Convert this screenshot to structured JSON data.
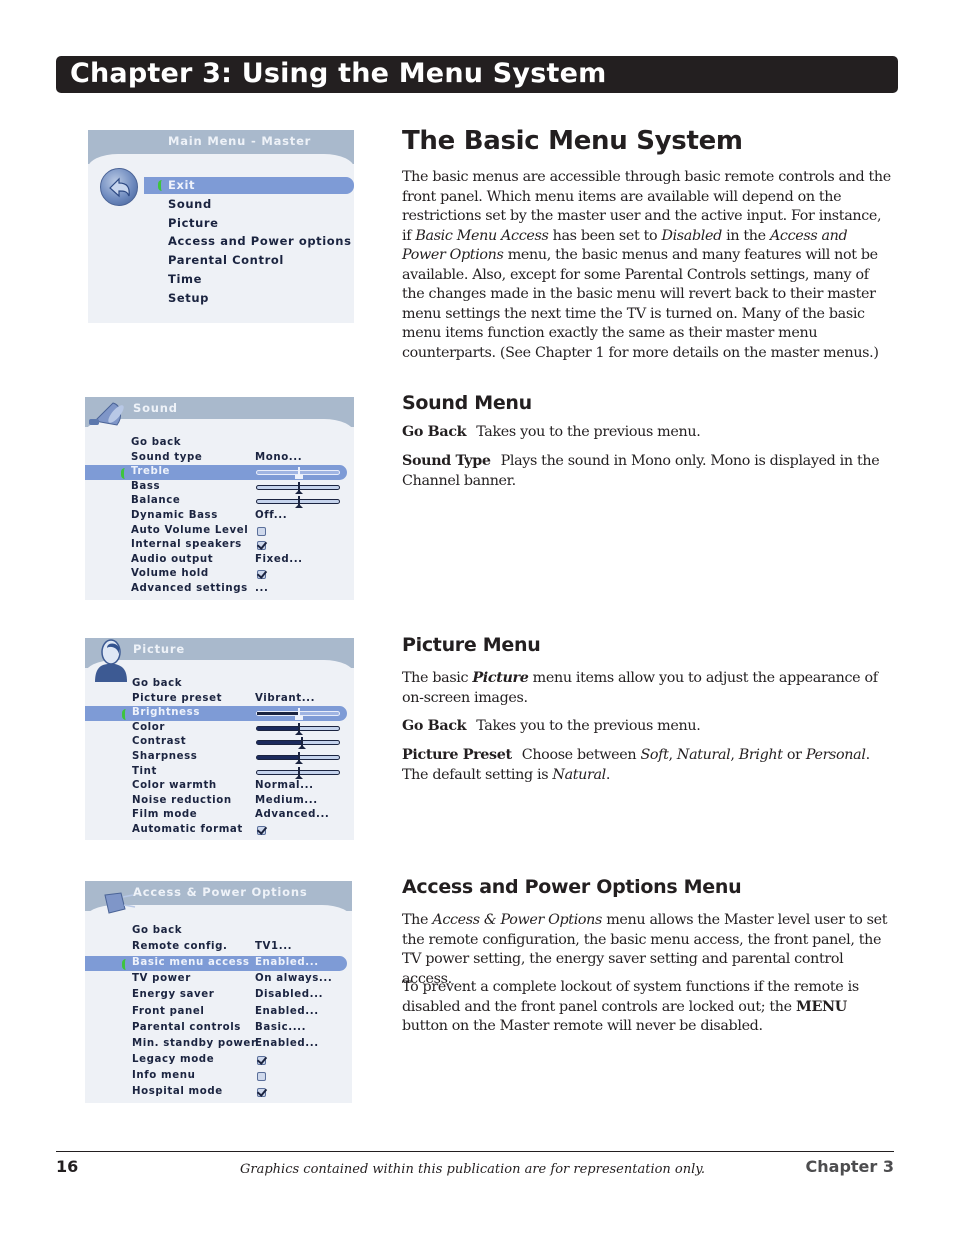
{
  "chapter_header": "Chapter 3: Using the Menu System",
  "sections": {
    "basic": {
      "title": "The Basic Menu System",
      "p1_a": "The basic menus are accessible through basic remote controls and the front panel. Which menu items are available will depend on the restrictions set by the master user and the active input. For instance, if ",
      "p1_em1": "Basic Menu Access",
      "p1_b": " has been set to ",
      "p1_em2": "Disabled",
      "p1_c": " in the ",
      "p1_em3": "Access and Power Options",
      "p1_d": " menu, the basic menus and many features will not be available. Also, except for some Parental Controls settings, many of the changes made in the basic menu will revert back to their master menu settings the next time the TV is turned on. Many of the basic menu items function exactly the same as their master menu counterparts. (See Chapter 1 for more details on the master menus.)"
    },
    "sound": {
      "title": "Sound Menu",
      "goback_term": "Go Back",
      "goback_desc": "Takes you to the previous menu.",
      "soundtype_term": "Sound Type",
      "soundtype_desc": "Plays the sound in Mono only. Mono is displayed in the Channel banner."
    },
    "picture": {
      "title": "Picture Menu",
      "intro_a": "The basic ",
      "intro_em": "Picture",
      "intro_b": " menu items allow you to adjust the appearance of on-screen images.",
      "goback_term": "Go Back",
      "goback_desc": "Takes you to the previous menu.",
      "preset_term": "Picture Preset",
      "preset_a": "Choose between ",
      "preset_em1": "Soft",
      "preset_sep1": ", ",
      "preset_em2": "Natural",
      "preset_sep2": ", ",
      "preset_em3": "Bright",
      "preset_or": " or ",
      "preset_em4": "Personal",
      "preset_b": ". The default setting is ",
      "preset_em5": "Natural",
      "preset_c": "."
    },
    "access": {
      "title": "Access and Power Options Menu",
      "p1_a": "The ",
      "p1_em": "Access & Power Options",
      "p1_b": " menu allows the Master level user to set the remote configuration, the basic menu access, the front panel, the TV power setting, the energy saver setting and parental control access.",
      "p2_a": "To prevent a complete lockout of  system functions if  the remote is disabled and the front panel controls are locked out; the ",
      "p2_strong": "MENU",
      "p2_b": " button on the Master remote will never be disabled."
    }
  },
  "menus": {
    "main": {
      "title": "Main Menu - Master",
      "icon": "back-arrow-icon",
      "items": [
        "Exit",
        "Sound",
        "Picture",
        "Access and Power options",
        "Parental Control",
        "Time",
        "Setup"
      ],
      "selected": 0
    },
    "sound": {
      "title": "Sound",
      "icon": "speaker-icon",
      "items": [
        {
          "label": "Go back",
          "type": "none"
        },
        {
          "label": "Sound type",
          "type": "text",
          "value": "Mono..."
        },
        {
          "label": "Treble",
          "type": "slider",
          "value": 0.5,
          "selected": true
        },
        {
          "label": "Bass",
          "type": "slider",
          "value": 0.5
        },
        {
          "label": "Balance",
          "type": "slider",
          "value": 0.5
        },
        {
          "label": "Dynamic Bass",
          "type": "text",
          "value": "Off..."
        },
        {
          "label": "Auto Volume Level",
          "type": "checkbox",
          "value": false
        },
        {
          "label": "Internal speakers",
          "type": "checkbox",
          "value": true
        },
        {
          "label": "Audio output",
          "type": "text",
          "value": "Fixed..."
        },
        {
          "label": "Volume hold",
          "type": "checkbox",
          "value": true
        },
        {
          "label": "Advanced settings",
          "type": "text",
          "value": "..."
        }
      ]
    },
    "picture": {
      "title": "Picture",
      "icon": "person-icon",
      "items": [
        {
          "label": "Go back",
          "type": "none"
        },
        {
          "label": "Picture preset",
          "type": "text",
          "value": "Vibrant..."
        },
        {
          "label": "Brightness",
          "type": "slider",
          "value": 0.5,
          "selected": true
        },
        {
          "label": "Color",
          "type": "slider",
          "value": 0.5
        },
        {
          "label": "Contrast",
          "type": "slider",
          "value": 0.53
        },
        {
          "label": "Sharpness",
          "type": "slider",
          "value": 0.5
        },
        {
          "label": "Tint",
          "type": "slider",
          "value": 0.5,
          "centered": true
        },
        {
          "label": "Color warmth",
          "type": "text",
          "value": "Normal..."
        },
        {
          "label": "Noise reduction",
          "type": "text",
          "value": "Medium..."
        },
        {
          "label": "Film mode",
          "type": "text",
          "value": "Advanced..."
        },
        {
          "label": "Automatic format",
          "type": "checkbox",
          "value": true
        }
      ]
    },
    "access": {
      "title": "Access & Power Options",
      "icon": "power-plug-icon",
      "items": [
        {
          "label": "Go back",
          "type": "none"
        },
        {
          "label": "Remote config.",
          "type": "text",
          "value": "TV1..."
        },
        {
          "label": "Basic menu access",
          "type": "text",
          "value": "Enabled...",
          "selected": true
        },
        {
          "label": "TV power",
          "type": "text",
          "value": "On always..."
        },
        {
          "label": "Energy saver",
          "type": "text",
          "value": "Disabled..."
        },
        {
          "label": "Front panel",
          "type": "text",
          "value": "Enabled..."
        },
        {
          "label": "Parental controls",
          "type": "text",
          "value": "Basic...."
        },
        {
          "label": "Min. standby power",
          "type": "text",
          "value": "Enabled..."
        },
        {
          "label": "Legacy mode",
          "type": "checkbox",
          "value": true
        },
        {
          "label": "Info menu",
          "type": "checkbox",
          "value": false
        },
        {
          "label": "Hospital mode",
          "type": "checkbox",
          "value": true
        }
      ]
    }
  },
  "footer": {
    "page_number": "16",
    "note": "Graphics contained within this publication are for representation only.",
    "chapter": "Chapter 3"
  }
}
